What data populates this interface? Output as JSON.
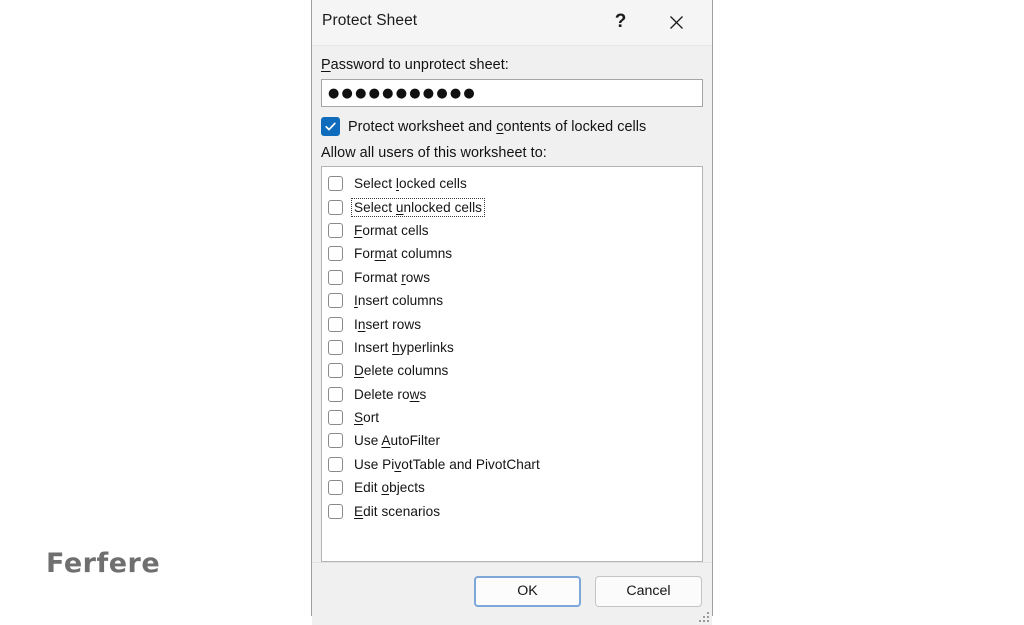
{
  "watermark": {
    "text": "Ferfere",
    "color": "#6f6f6f"
  },
  "dialog": {
    "title": "Protect Sheet",
    "help_icon": "question-mark-icon",
    "close_icon": "close-icon",
    "password": {
      "label_prefix": "P",
      "label_rest": "assword to unprotect sheet:",
      "value": "●●●●●●●●●●●",
      "placeholder": ""
    },
    "protect_checkbox": {
      "checked": true,
      "accent_color": "#0f6cbd",
      "label_before": "Protect worksheet and ",
      "label_accel": "c",
      "label_after": "ontents of locked cells"
    },
    "allow_label": "Allow all users of this worksheet to:",
    "permissions": [
      {
        "before": "Select ",
        "accel": "l",
        "after": "ocked cells",
        "checked": false,
        "focused": false
      },
      {
        "before": "Select ",
        "accel": "u",
        "after": "nlocked cells",
        "checked": false,
        "focused": true
      },
      {
        "before": "",
        "accel": "F",
        "after": "ormat cells",
        "checked": false,
        "focused": false
      },
      {
        "before": "For",
        "accel": "m",
        "after": "at columns",
        "checked": false,
        "focused": false
      },
      {
        "before": "Format ",
        "accel": "r",
        "after": "ows",
        "checked": false,
        "focused": false
      },
      {
        "before": "",
        "accel": "I",
        "after": "nsert columns",
        "checked": false,
        "focused": false
      },
      {
        "before": "I",
        "accel": "n",
        "after": "sert rows",
        "checked": false,
        "focused": false
      },
      {
        "before": "Insert ",
        "accel": "h",
        "after": "yperlinks",
        "checked": false,
        "focused": false
      },
      {
        "before": "",
        "accel": "D",
        "after": "elete columns",
        "checked": false,
        "focused": false
      },
      {
        "before": "Delete ro",
        "accel": "w",
        "after": "s",
        "checked": false,
        "focused": false
      },
      {
        "before": "",
        "accel": "S",
        "after": "ort",
        "checked": false,
        "focused": false
      },
      {
        "before": "Use ",
        "accel": "A",
        "after": "utoFilter",
        "checked": false,
        "focused": false
      },
      {
        "before": "Use Pi",
        "accel": "v",
        "after": "otTable and PivotChart",
        "checked": false,
        "focused": false
      },
      {
        "before": "Edit ",
        "accel": "o",
        "after": "bjects",
        "checked": false,
        "focused": false
      },
      {
        "before": "",
        "accel": "E",
        "after": "dit scenarios",
        "checked": false,
        "focused": false
      }
    ],
    "buttons": {
      "ok": "OK",
      "cancel": "Cancel",
      "ok_border_color": "#7da7d9"
    },
    "resize_grip": "resize-grip-icon"
  }
}
